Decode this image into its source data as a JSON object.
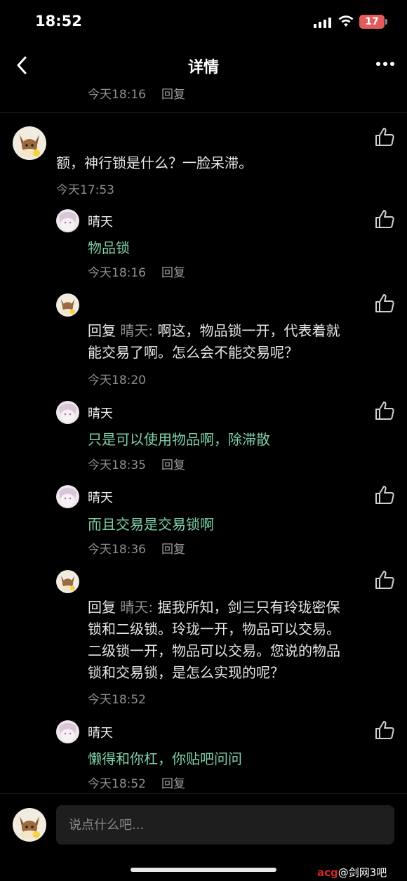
{
  "status": {
    "time": "18:52",
    "battery": "17"
  },
  "nav": {
    "title": "详情"
  },
  "top_meta": {
    "time": "今天18:16",
    "reply": "回复"
  },
  "main_comment": {
    "text": "额，神行锁是什么？一脸呆滞。",
    "time": "今天17:53"
  },
  "replies": [
    {
      "user": "晴天",
      "text": "物品锁",
      "time": "今天18:16",
      "reply": "回复"
    },
    {
      "prefix": "回复",
      "ref": "晴天:",
      "lines": [
        "啊这，物品锁一开，代表着就",
        "能交易了啊。怎么会不能交易呢？"
      ],
      "time": "今天18:20"
    },
    {
      "user": "晴天",
      "text": "只是可以使用物品啊，除滞散",
      "time": "今天18:35",
      "reply": "回复"
    },
    {
      "user": "晴天",
      "text": "而且交易是交易锁啊",
      "time": "今天18:36",
      "reply": "回复"
    },
    {
      "prefix": "回复",
      "ref": "晴天:",
      "lines": [
        "据我所知，剑三只有玲珑密保",
        "锁和二级锁。玲珑一开，物品可以交易。",
        "二级锁一开，物品可以交易。您说的物品",
        "锁和交易锁，是怎么实现的呢？"
      ],
      "time": "今天18:52"
    },
    {
      "user": "晴天",
      "text": "懒得和你杠，你贴吧问问",
      "time": "今天18:52",
      "reply": "回复"
    }
  ],
  "input": {
    "placeholder": "说点什么吧..."
  },
  "watermark": {
    "left": "acg",
    "right": "@剑网3吧"
  }
}
